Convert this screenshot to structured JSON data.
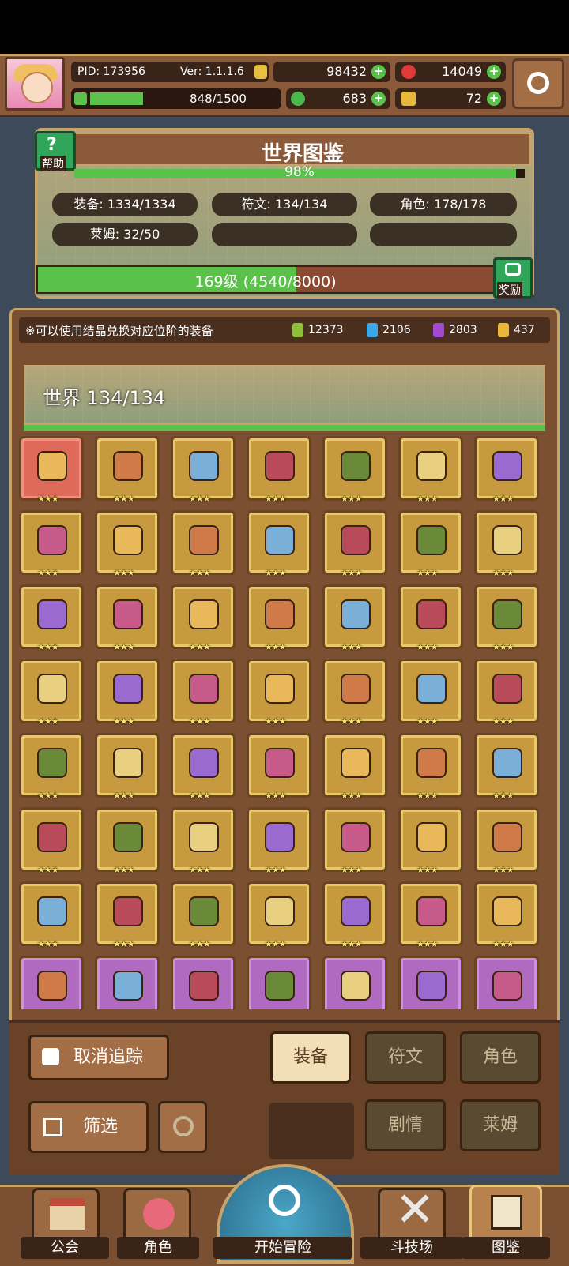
{
  "header": {
    "pid": "PID: 173956",
    "ver": "Ver: 1.1.1.6",
    "gold": "98432",
    "gems": "14049",
    "clover": "683",
    "keys": "72",
    "exp": "848/1500",
    "exp_fraction": 0.565
  },
  "codex": {
    "title": "世界图鉴",
    "help": "帮助",
    "percent": "98%",
    "percent_value": 0.98,
    "stats": [
      "装备: 1334/1334",
      "符文: 134/134",
      "角色: 178/178",
      "莱姆: 32/50"
    ],
    "level": "169级 (4540/8000)",
    "level_fraction": 0.5675,
    "reward": "奖励"
  },
  "crystals": {
    "note": "※可以使用结晶兑换对应位阶的装备",
    "items": [
      {
        "icon": "green-crystal-icon",
        "value": "12373",
        "color": "#8fbf3a"
      },
      {
        "icon": "blue-crystal-icon",
        "value": "2106",
        "color": "#3aa8e8"
      },
      {
        "icon": "purple-crystal-icon",
        "value": "2803",
        "color": "#a04ad0"
      },
      {
        "icon": "gold-crystal-icon",
        "value": "437",
        "color": "#e8b83a"
      }
    ]
  },
  "world": {
    "title": "世界  134/134"
  },
  "grid": {
    "stars": "★★★",
    "rows": [
      [
        "helmet-icon",
        "staff-icon",
        "ring-icon",
        "armor-icon",
        "glove-icon",
        "amulet-icon",
        "boots-icon"
      ],
      [
        "sword-icon",
        "shield-icon",
        "wing-shield-icon",
        "crown-icon",
        "necklace-icon",
        "orb-icon",
        "wand-icon"
      ],
      [
        "blue-orb-icon",
        "chalice-icon",
        "gem-icon",
        "dark-necklace-icon",
        "ogre-icon",
        "cloak-icon",
        "red-ring-icon"
      ],
      [
        "green-bag-icon",
        "tiara-icon",
        "jewel-icon",
        "gold-necklace-icon",
        "bow-icon",
        "bone-icon",
        "gold-ring-icon"
      ],
      [
        "fire-gem-icon",
        "heart-ring-icon",
        "fire-ring-icon",
        "bear-icon",
        "pink-bear-icon",
        "pink-dress-icon",
        "wing-heart-icon"
      ],
      [
        "heart-necklace-icon",
        "angel-ring-icon",
        "gold-cannon-icon",
        "gold-band-icon",
        "gold-boots-icon",
        "gold-armor-icon",
        "gold-pendant-icon"
      ],
      [
        "gold-helm-icon",
        "crossed-swords-icon",
        "dual-blades-icon",
        "gold-shield-icon",
        "feather-boots-icon",
        "dark-crown-icon",
        "green-boots-icon"
      ],
      [
        "purple-sword-icon",
        "purple-staff-icon",
        "purple-crown-icon",
        "purple-helm-icon",
        "purple-armor-icon",
        "purple-necklace-icon",
        "purple-boot-icon"
      ]
    ]
  },
  "actions": {
    "untrack": "取消追踪",
    "filter": "筛选",
    "tab_equip": "装备",
    "tab_rune": "符文",
    "tab_role": "角色",
    "tab_story": "剧情",
    "tab_slime": "莱姆"
  },
  "nav": {
    "guild": "公会",
    "role": "角色",
    "adventure": "开始冒险",
    "arena": "斗技场",
    "codex": "图鉴"
  }
}
